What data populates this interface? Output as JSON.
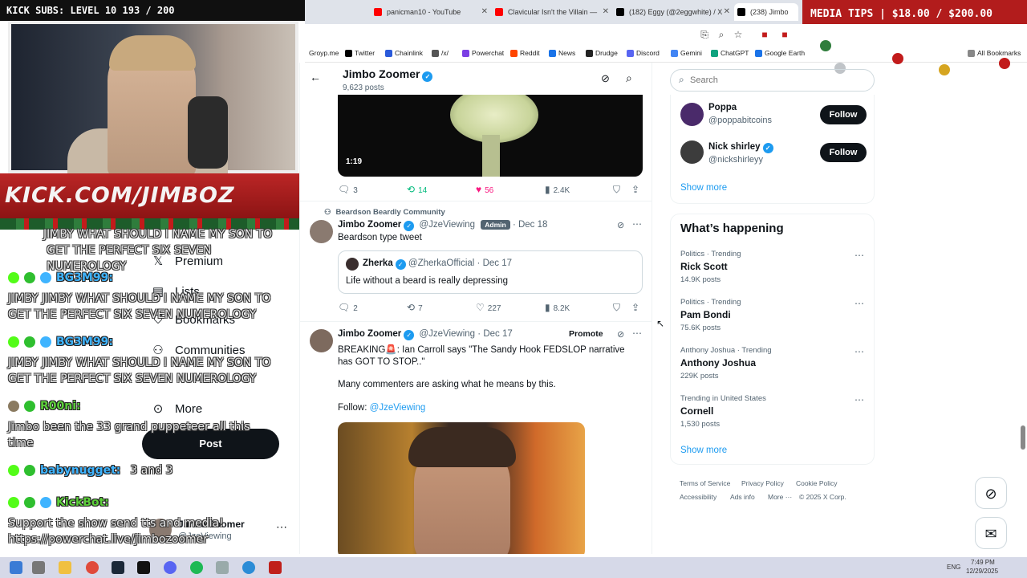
{
  "stream": {
    "kick_subs": "KICK SUBS: LEVEL 10 193 / 200",
    "kick_url": "KICK.COM/JIMBOZ",
    "media_tips": "MEDIA TIPS | $18.00 / $200.00",
    "chat": [
      {
        "user": "",
        "text": "JIMBY WHAT SHOULD I NAME MY SON TO GET THE PERFECT SIX SEVEN NUMEROLOGY",
        "color": "#2fbf2f"
      },
      {
        "user": "BG3M99:",
        "text": "JIMBY JIMBY WHAT SHOULD I NAME MY SON TO GET THE PERFECT SIX SEVEN NUMEROLOGY",
        "color": "#3fb4ff"
      },
      {
        "user": "BG3M99:",
        "text": "JIMBY JIMBY WHAT SHOULD I NAME MY SON TO GET THE PERFECT SIX SEVEN NUMEROLOGY",
        "color": "#3fb4ff"
      },
      {
        "user": "R00ni:",
        "text": "Jimbo been the 33 grand puppeteer all this time",
        "color": "#5ccf3a"
      },
      {
        "user": "babynugget:",
        "text": "3 and 3",
        "color": "#3fb4ff"
      },
      {
        "user": "KickBot:",
        "text": "Support the show send tts and media! https://powerchat.live/jimbozoomer",
        "color": "#5ccf3a"
      }
    ]
  },
  "browser": {
    "tabs": [
      {
        "label": "panicman10 - YouTube",
        "color": "#ff0000"
      },
      {
        "label": "Clavicular Isn't the Villain —",
        "color": "#ff0000"
      },
      {
        "label": "(182) Eggy (@2eggwhite) / X",
        "color": "#000000"
      },
      {
        "label": "(238) Jimbo",
        "color": "#000000"
      }
    ],
    "bookmarks": [
      {
        "label": "Groyp.me",
        "color": "#888888"
      },
      {
        "label": "Twitter",
        "color": "#000000"
      },
      {
        "label": "Chainlink",
        "color": "#2a5ada"
      },
      {
        "label": "/x/",
        "color": "#333333"
      },
      {
        "label": "Powerchat",
        "color": "#7b3fe4"
      },
      {
        "label": "Reddit",
        "color": "#ff4500"
      },
      {
        "label": "News",
        "color": "#1a73e8"
      },
      {
        "label": "Drudge",
        "color": "#222222"
      },
      {
        "label": "Discord",
        "color": "#5865f2"
      },
      {
        "label": "Gemini",
        "color": "#4285f4"
      },
      {
        "label": "ChatGPT",
        "color": "#10a37f"
      },
      {
        "label": "Google Earth",
        "color": "#1a73e8"
      }
    ],
    "all_bookmarks": "All Bookmarks"
  },
  "x": {
    "nav": [
      {
        "label": "Premium",
        "icon": "x-icon"
      },
      {
        "label": "Lists",
        "icon": "list-icon"
      },
      {
        "label": "Bookmarks",
        "icon": "bookmark-icon"
      },
      {
        "label": "Communities",
        "icon": "communities-icon"
      },
      {
        "label": "More",
        "icon": "more-icon"
      }
    ],
    "post_button": "Post",
    "account": {
      "name": "Jimbo Zoomer",
      "handle": "@JzeViewing"
    },
    "header": {
      "name": "Jimbo Zoomer",
      "posts": "9,623 posts"
    },
    "tweet1": {
      "video_duration": "1:19",
      "replies": "3",
      "reposts": "14",
      "likes": "56",
      "views": "2.4K"
    },
    "tweet2": {
      "community": "Beardson Beardly Community",
      "name": "Jimbo Zoomer",
      "handle": "@JzeViewing",
      "badge": "Admin",
      "date": "Dec 18",
      "text": "Beardson type tweet",
      "quote": {
        "name": "Zherka",
        "handle": "@ZherkaOfficial",
        "date": "Dec 17",
        "text": "Life without a beard is really depressing"
      },
      "replies": "2",
      "reposts": "7",
      "likes": "227",
      "views": "8.2K"
    },
    "tweet3": {
      "name": "Jimbo Zoomer",
      "handle": "@JzeViewing",
      "date": "Dec 17",
      "promote": "Promote",
      "text1": "BREAKING🚨: Ian Carroll says \"The Sandy Hook FEDSLOP narrative has GOT TO STOP..\"",
      "text2": "Many commenters are asking what he means by this.",
      "follow_label": "Follow:",
      "follow_handle": "@JzeViewing"
    },
    "search_placeholder": "Search",
    "who_to_follow": [
      {
        "name": "Poppa",
        "handle": "@poppabitcoins",
        "verified": false,
        "button": "Follow"
      },
      {
        "name": "Nick shirley",
        "handle": "@nickshirleyy",
        "verified": true,
        "button": "Follow"
      }
    ],
    "show_more": "Show more",
    "happening_title": "What’s happening",
    "trends": [
      {
        "meta": "Politics · Trending",
        "name": "Rick Scott",
        "count": "14.9K posts"
      },
      {
        "meta": "Politics · Trending",
        "name": "Pam Bondi",
        "count": "75.6K posts"
      },
      {
        "meta": "Anthony Joshua · Trending",
        "name": "Anthony Joshua",
        "count": "229K posts"
      },
      {
        "meta": "Trending in United States",
        "name": "Cornell",
        "count": "1,530 posts"
      }
    ],
    "show_more2": "Show more",
    "footer": [
      "Terms of Service",
      "Privacy Policy",
      "Cookie Policy",
      "Accessibility",
      "Ads info",
      "More ···",
      "© 2025 X Corp."
    ]
  },
  "taskbar": {
    "lang": "ENG",
    "time": "7:49 PM",
    "date": "12/29/2025"
  }
}
